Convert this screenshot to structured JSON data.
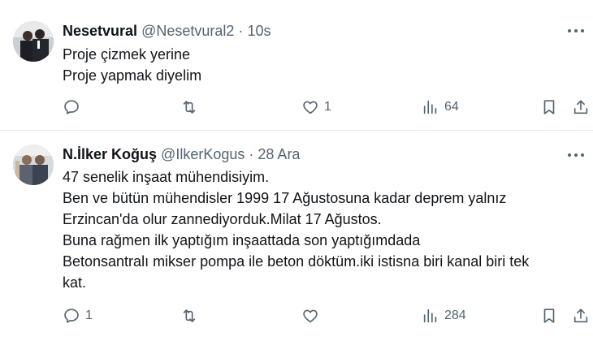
{
  "tweets": [
    {
      "name": "Nesetvural",
      "handle": "@Nesetvural2",
      "separator": "·",
      "time": "10s",
      "lines": [
        "Proje çizmek yerine",
        "Proje yapmak diyelim"
      ],
      "replies": "",
      "retweets": "",
      "likes": "1",
      "views": "64"
    },
    {
      "name": "N.İlker Koğuş",
      "handle": "@IlkerKogus",
      "separator": "·",
      "time": "28 Ara",
      "lines": [
        "47 senelik inşaat mühendisiyim.",
        "Ben ve bütün mühendisler 1999 17 Ağustosuna kadar deprem yalnız",
        "Erzincan'da olur zannediyorduk.Milat 17 Ağustos.",
        "Buna rağmen ilk yaptığım inşaattada son yaptığımdada",
        "Betonsantralı mikser pompa ile beton döktüm.iki istisna biri kanal biri tek",
        "kat."
      ],
      "replies": "1",
      "retweets": "",
      "likes": "",
      "views": "284"
    }
  ],
  "icons": {
    "reply": "reply-icon",
    "retweet": "retweet-icon",
    "like": "like-icon",
    "views": "views-icon",
    "bookmark": "bookmark-icon",
    "share": "share-icon",
    "more": "more-icon"
  },
  "colors": {
    "text": "#0f1419",
    "secondary": "#536471",
    "divider": "#e6e9ec"
  }
}
